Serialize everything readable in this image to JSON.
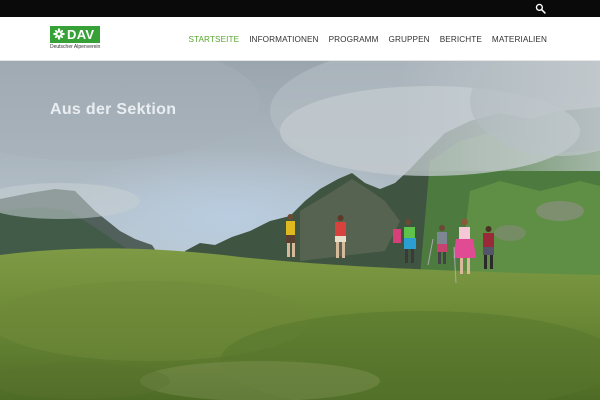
{
  "topbar": {
    "search_icon": "search-icon"
  },
  "logo": {
    "brand": "DAV",
    "subtitle": "Deutscher Alpenverein",
    "brand_color": "#35a136",
    "icon": "edelweiss-icon"
  },
  "nav": {
    "items": [
      {
        "label": "STARTSEITE",
        "active": true
      },
      {
        "label": "INFORMATIONEN",
        "active": false
      },
      {
        "label": "PROGRAMM",
        "active": false
      },
      {
        "label": "GRUPPEN",
        "active": false
      },
      {
        "label": "BERICHTE",
        "active": false
      },
      {
        "label": "MATERIALIEN",
        "active": false
      }
    ],
    "active_color": "#5aa530"
  },
  "hero": {
    "title": "Aus der Sektion"
  }
}
